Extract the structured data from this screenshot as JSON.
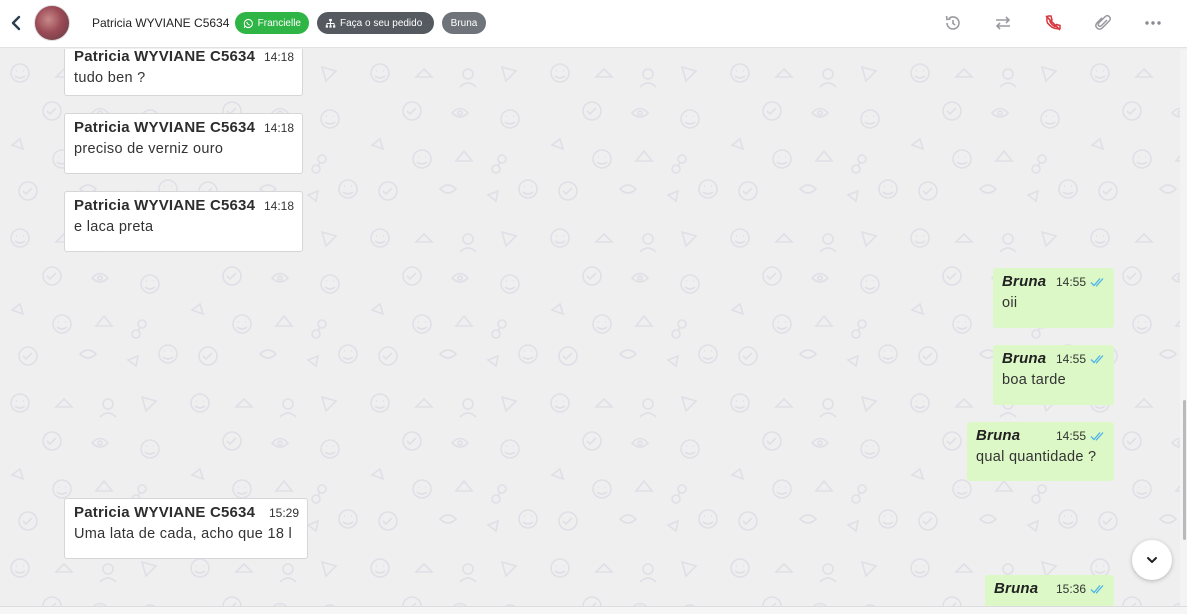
{
  "header": {
    "contact_name": "Patricia WYVIANE C5634",
    "tags": [
      {
        "label": "Francielle",
        "color": "#2fb545",
        "icon": "whatsapp-icon"
      },
      {
        "label": "Faça o seu pedido",
        "color": "#555a60",
        "icon": "sitemap-icon"
      },
      {
        "label": "Bruna",
        "color": "#6e747a"
      }
    ],
    "icons": [
      "history-icon",
      "transfer-icon",
      "phone-off-icon",
      "attach-icon",
      "more-icon"
    ]
  },
  "messages": [
    {
      "direction": "in",
      "sender": "Patricia WYVIANE C5634",
      "time": "14:18",
      "text": "tudo ben ?"
    },
    {
      "direction": "in",
      "sender": "Patricia WYVIANE C5634",
      "time": "14:18",
      "text": "preciso de verniz ouro"
    },
    {
      "direction": "in",
      "sender": "Patricia WYVIANE C5634",
      "time": "14:18",
      "text": "e laca preta"
    },
    {
      "direction": "out",
      "sender": "Bruna",
      "time": "14:55",
      "text": "oii",
      "status": "read"
    },
    {
      "direction": "out",
      "sender": "Bruna",
      "time": "14:55",
      "text": "boa tarde",
      "status": "read"
    },
    {
      "direction": "out",
      "sender": "Bruna",
      "time": "14:55",
      "text": "qual quantidade ?",
      "status": "read"
    },
    {
      "direction": "in",
      "sender": "Patricia WYVIANE C5634",
      "time": "15:29",
      "text": "Uma lata de cada, acho que 18 l"
    },
    {
      "direction": "out",
      "sender": "Bruna",
      "time": "15:36",
      "text": "",
      "status": "read"
    }
  ],
  "colors": {
    "incoming_bg": "#ffffff",
    "outgoing_bg": "#dcf8c6",
    "read_tick": "#4fb3e8",
    "chat_bg": "#efeff0"
  }
}
